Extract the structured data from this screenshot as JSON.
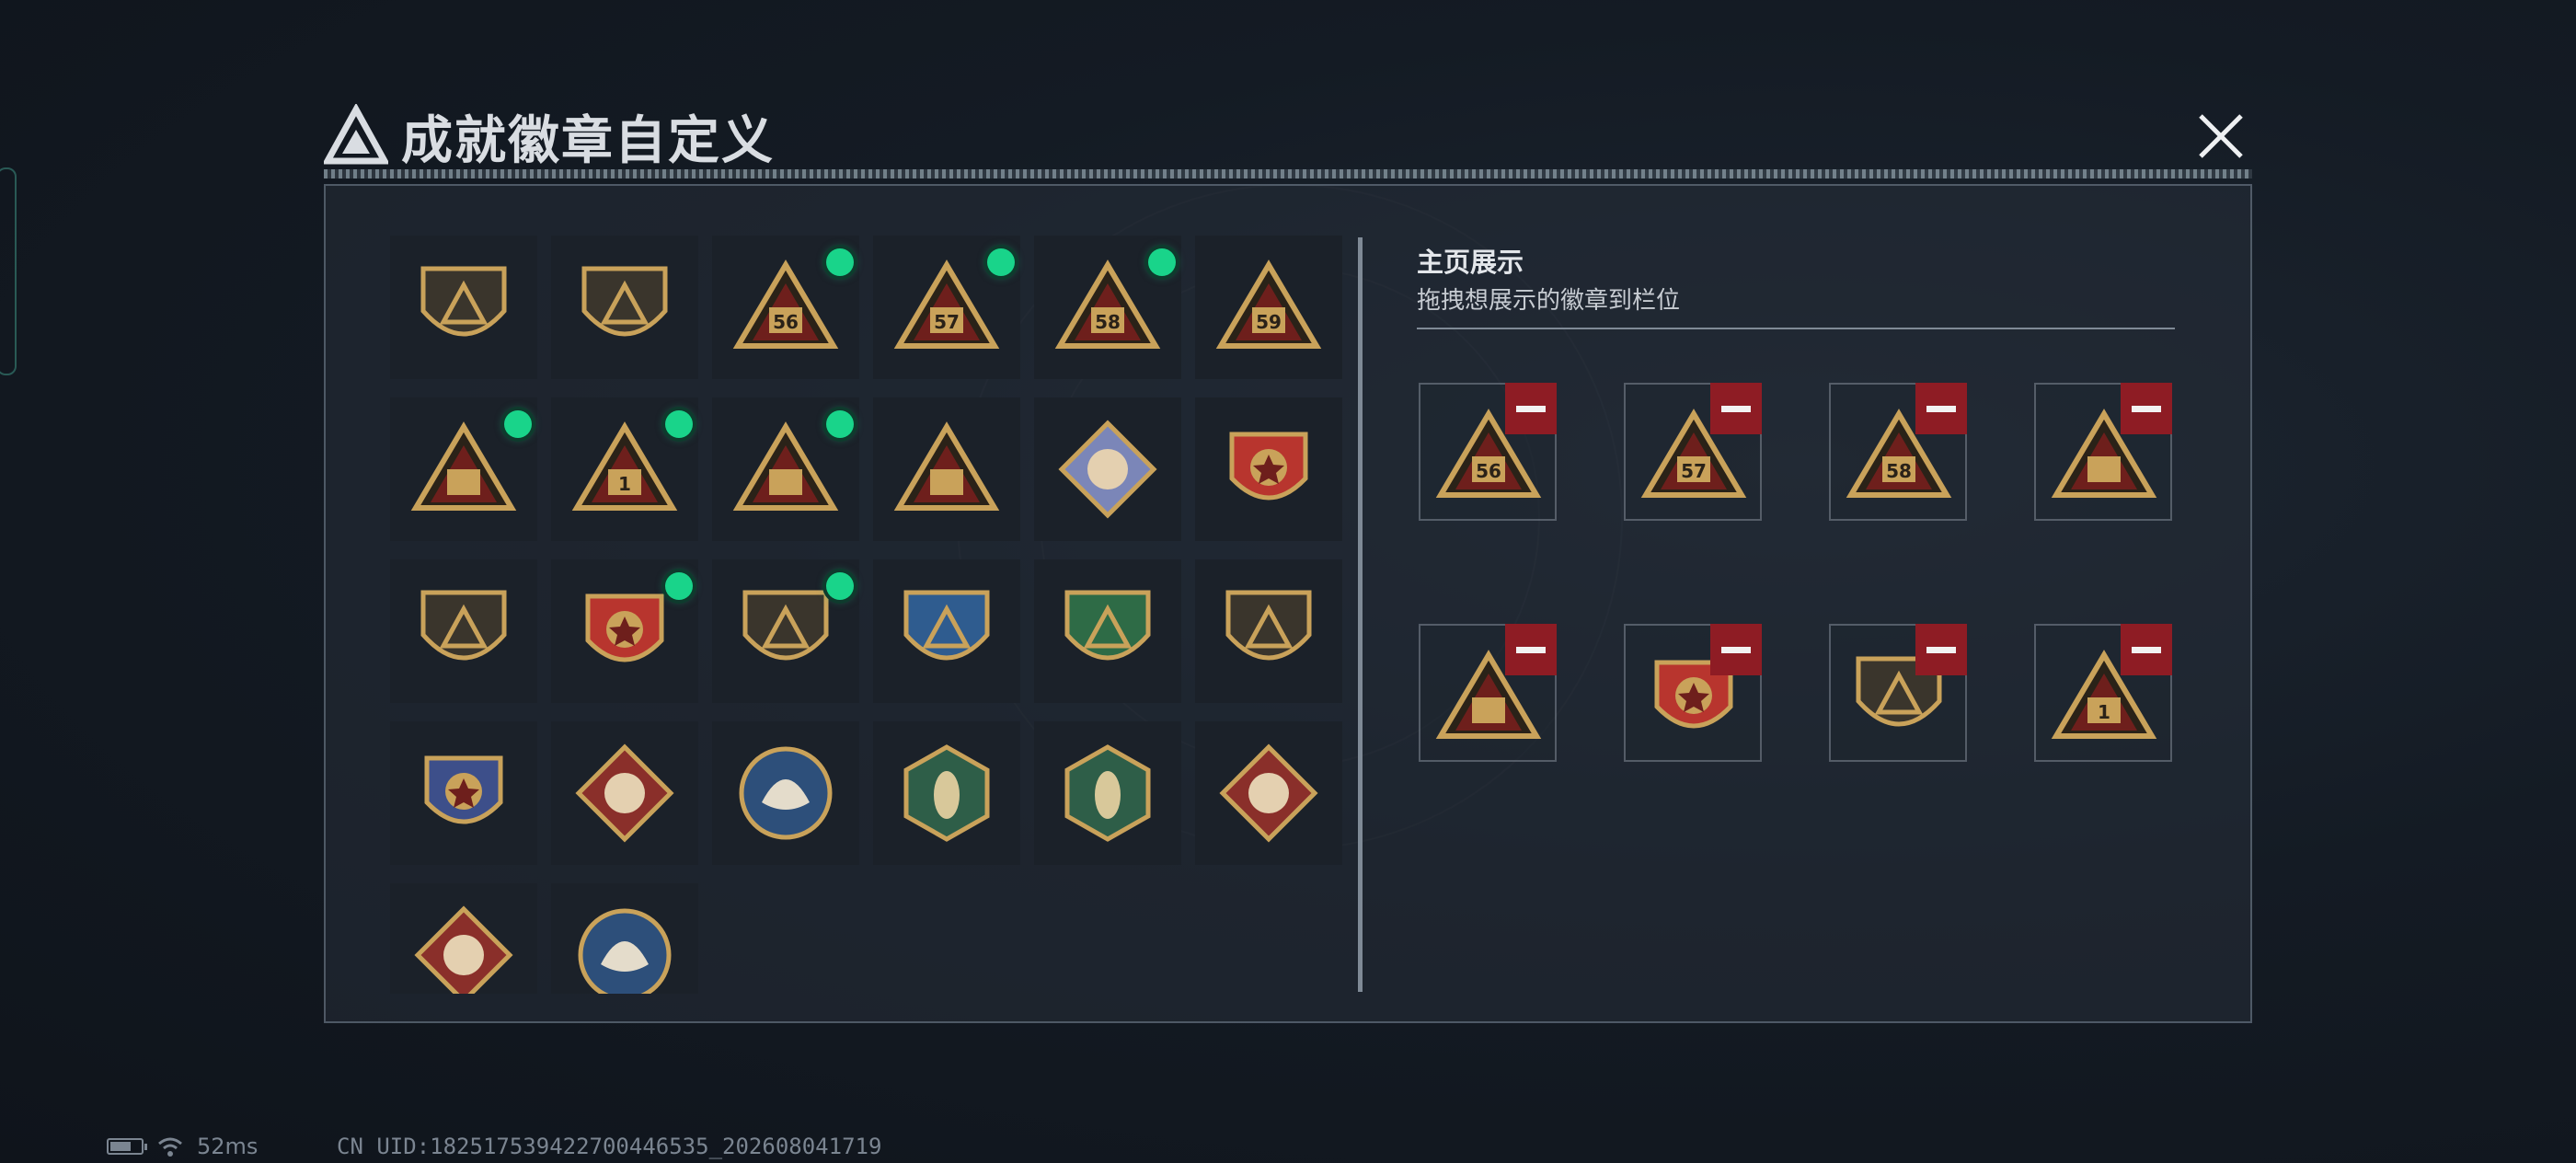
{
  "dialog": {
    "title": "成就徽章自定义",
    "close_icon": "close-icon"
  },
  "badges": [
    {
      "name": "triangle-logo-shield-badge",
      "color": "#c9a25a",
      "dot": false
    },
    {
      "name": "helicopter-shield-badge",
      "color": "#c9a25a",
      "dot": false
    },
    {
      "name": "season-56-badge",
      "color": "#c9a25a",
      "dot": true,
      "label": "56"
    },
    {
      "name": "season-57-badge",
      "color": "#c9a25a",
      "dot": true,
      "label": "57"
    },
    {
      "name": "season-58-badge",
      "color": "#c9a25a",
      "dot": true,
      "label": "58"
    },
    {
      "name": "season-59-badge",
      "color": "#c9a25a",
      "dot": false,
      "label": "59"
    },
    {
      "name": "eggs-triangle-badge",
      "color": "#c9a25a",
      "dot": true
    },
    {
      "name": "number-one-triangle-badge",
      "color": "#c9a25a",
      "dot": true,
      "label": "1"
    },
    {
      "name": "squad-triangle-badge",
      "color": "#c9a25a",
      "dot": true
    },
    {
      "name": "rocket-triangle-badge",
      "color": "#c9a25a",
      "dot": false
    },
    {
      "name": "rose-diamond-badge",
      "color": "#7b86b8",
      "dot": false
    },
    {
      "name": "star-medal-badge",
      "color": "#b8352e",
      "dot": false
    },
    {
      "name": "rank-shield-badge",
      "color": "#c9a25a",
      "dot": false
    },
    {
      "name": "winged-medal-badge",
      "color": "#b8352e",
      "dot": true
    },
    {
      "name": "gem-shield-badge",
      "color": "#c9a25a",
      "dot": true
    },
    {
      "name": "sniper-blue-shield-badge",
      "color": "#2f5c8f",
      "dot": false
    },
    {
      "name": "sniper-green-shield-badge",
      "color": "#2e6b46",
      "dot": false
    },
    {
      "name": "rifle-shield-badge",
      "color": "#c9a25a",
      "dot": false
    },
    {
      "name": "rifles-crest-badge",
      "color": "#3d4f8a",
      "dot": false
    },
    {
      "name": "wolf-diamond-badge",
      "color": "#8a2f2a",
      "dot": false
    },
    {
      "name": "eagle-circle-badge",
      "color": "#2d4f7a",
      "dot": false
    },
    {
      "name": "wasp-hexagon-badge",
      "color": "#2e5e48",
      "dot": false
    },
    {
      "name": "wasp-hexagon-badge-2",
      "color": "#2e5e48",
      "dot": false
    },
    {
      "name": "dragon-diamond-badge",
      "color": "#8a2f2a",
      "dot": false
    },
    {
      "name": "runner-diamond-badge",
      "color": "#8a2f2a",
      "dot": false
    },
    {
      "name": "lynx-circle-badge",
      "color": "#2d4f7a",
      "dot": false
    }
  ],
  "showcase": {
    "title": "主页展示",
    "subtitle": "拖拽想展示的徽章到栏位",
    "slots": [
      {
        "name": "season-56-badge",
        "label": "56"
      },
      {
        "name": "season-57-badge",
        "label": "57"
      },
      {
        "name": "season-58-badge",
        "label": "58"
      },
      {
        "name": "eggs-triangle-badge"
      },
      {
        "name": "squad-triangle-badge"
      },
      {
        "name": "winged-medal-badge"
      },
      {
        "name": "gem-shield-badge"
      },
      {
        "name": "number-one-triangle-badge",
        "label": "1"
      }
    ],
    "remove_icon": "minus-icon"
  },
  "status_bar": {
    "ping": "52ms",
    "uid": "CN UID:18251753942270044653­5_202608041719"
  }
}
